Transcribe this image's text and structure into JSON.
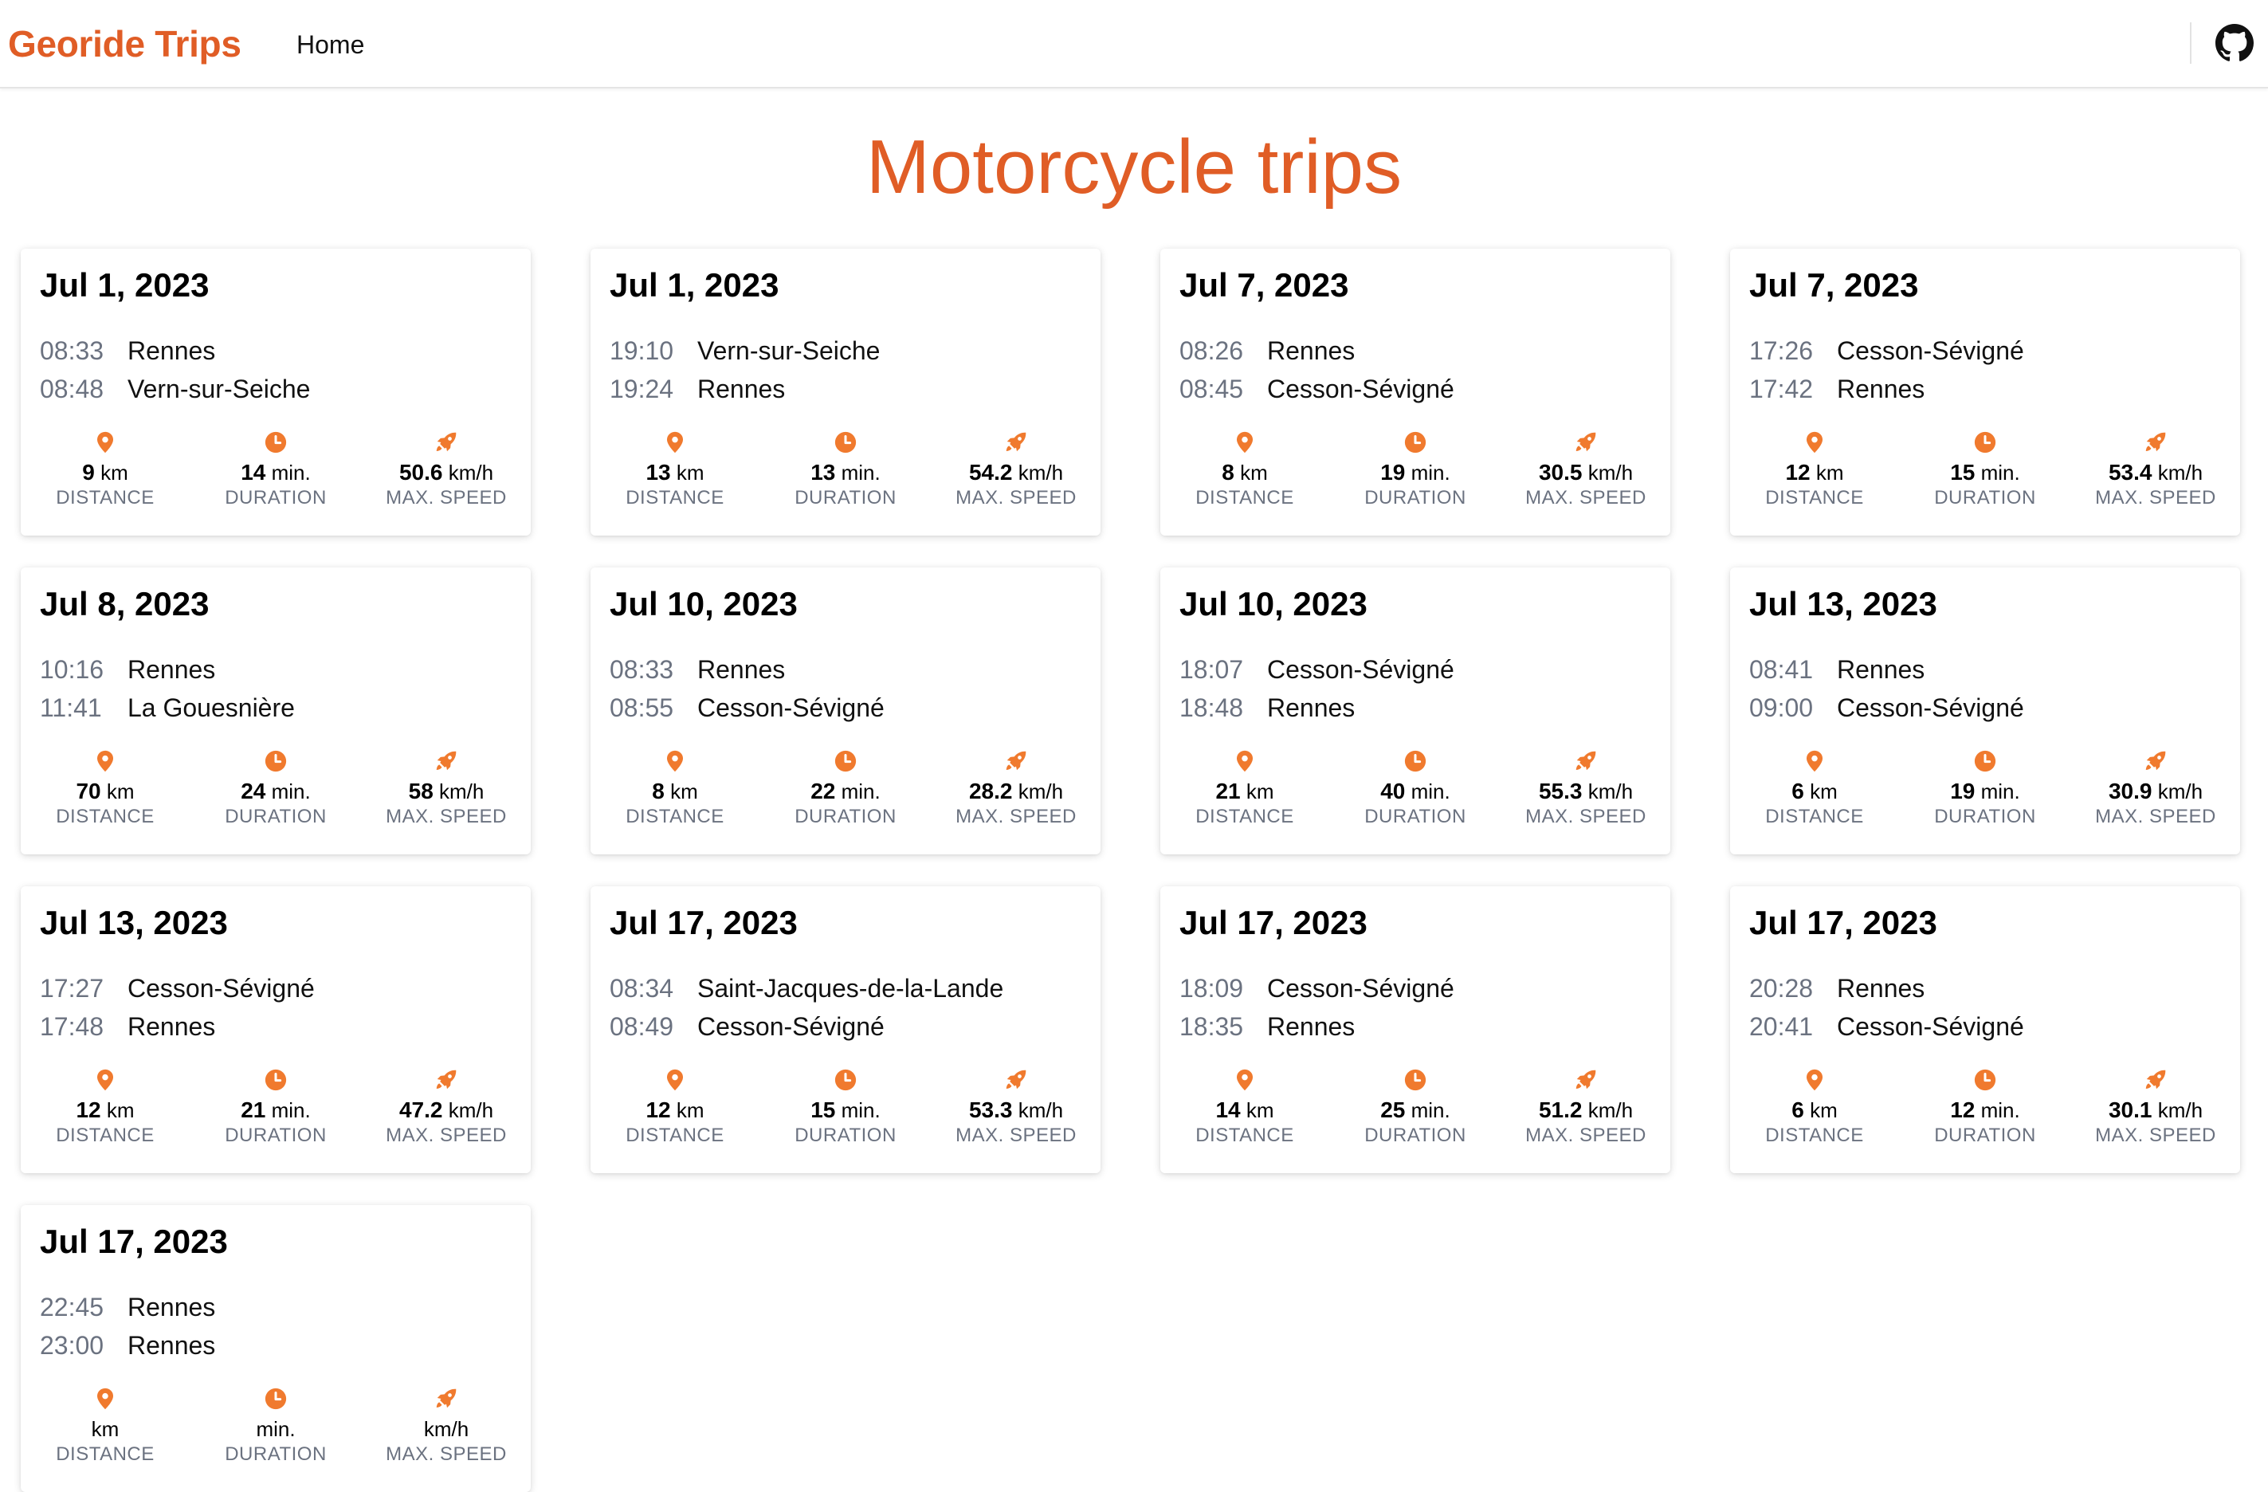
{
  "nav": {
    "brand": "Georide Trips",
    "home": "Home",
    "github_icon": "github-icon"
  },
  "page": {
    "title": "Motorcycle trips"
  },
  "colors": {
    "accent": "#e05d26",
    "icon": "#f07a2e",
    "muted": "#6b7280"
  },
  "labels": {
    "distance": "DISTANCE",
    "duration": "DURATION",
    "max_speed": "MAX. SPEED",
    "km": "km",
    "min": "min.",
    "kmh": "km/h"
  },
  "icons": {
    "distance": "map-pin-icon",
    "duration": "clock-icon",
    "max_speed": "rocket-icon"
  },
  "trips": [
    {
      "date": "Jul 1, 2023",
      "start_time": "08:33",
      "start_place": "Rennes",
      "end_time": "08:48",
      "end_place": "Vern-sur-Seiche",
      "distance": "9",
      "duration": "14",
      "max_speed": "50.6"
    },
    {
      "date": "Jul 1, 2023",
      "start_time": "19:10",
      "start_place": "Vern-sur-Seiche",
      "end_time": "19:24",
      "end_place": "Rennes",
      "distance": "13",
      "duration": "13",
      "max_speed": "54.2"
    },
    {
      "date": "Jul 7, 2023",
      "start_time": "08:26",
      "start_place": "Rennes",
      "end_time": "08:45",
      "end_place": "Cesson-Sévigné",
      "distance": "8",
      "duration": "19",
      "max_speed": "30.5"
    },
    {
      "date": "Jul 7, 2023",
      "start_time": "17:26",
      "start_place": "Cesson-Sévigné",
      "end_time": "17:42",
      "end_place": "Rennes",
      "distance": "12",
      "duration": "15",
      "max_speed": "53.4"
    },
    {
      "date": "Jul 8, 2023",
      "start_time": "10:16",
      "start_place": "Rennes",
      "end_time": "11:41",
      "end_place": "La Gouesnière",
      "distance": "70",
      "duration": "24",
      "max_speed": "58"
    },
    {
      "date": "Jul 10, 2023",
      "start_time": "08:33",
      "start_place": "Rennes",
      "end_time": "08:55",
      "end_place": "Cesson-Sévigné",
      "distance": "8",
      "duration": "22",
      "max_speed": "28.2"
    },
    {
      "date": "Jul 10, 2023",
      "start_time": "18:07",
      "start_place": "Cesson-Sévigné",
      "end_time": "18:48",
      "end_place": "Rennes",
      "distance": "21",
      "duration": "40",
      "max_speed": "55.3"
    },
    {
      "date": "Jul 13, 2023",
      "start_time": "08:41",
      "start_place": "Rennes",
      "end_time": "09:00",
      "end_place": "Cesson-Sévigné",
      "distance": "6",
      "duration": "19",
      "max_speed": "30.9"
    },
    {
      "date": "Jul 13, 2023",
      "start_time": "17:27",
      "start_place": "Cesson-Sévigné",
      "end_time": "17:48",
      "end_place": "Rennes",
      "distance": "12",
      "duration": "21",
      "max_speed": "47.2"
    },
    {
      "date": "Jul 17, 2023",
      "start_time": "08:34",
      "start_place": "Saint-Jacques-de-la-Lande",
      "end_time": "08:49",
      "end_place": "Cesson-Sévigné",
      "distance": "12",
      "duration": "15",
      "max_speed": "53.3"
    },
    {
      "date": "Jul 17, 2023",
      "start_time": "18:09",
      "start_place": "Cesson-Sévigné",
      "end_time": "18:35",
      "end_place": "Rennes",
      "distance": "14",
      "duration": "25",
      "max_speed": "51.2"
    },
    {
      "date": "Jul 17, 2023",
      "start_time": "20:28",
      "start_place": "Rennes",
      "end_time": "20:41",
      "end_place": "Cesson-Sévigné",
      "distance": "6",
      "duration": "12",
      "max_speed": "30.1"
    },
    {
      "date": "Jul 17, 2023",
      "start_time": "22:45",
      "start_place": "Rennes",
      "end_time": "23:00",
      "end_place": "Rennes"
    }
  ]
}
